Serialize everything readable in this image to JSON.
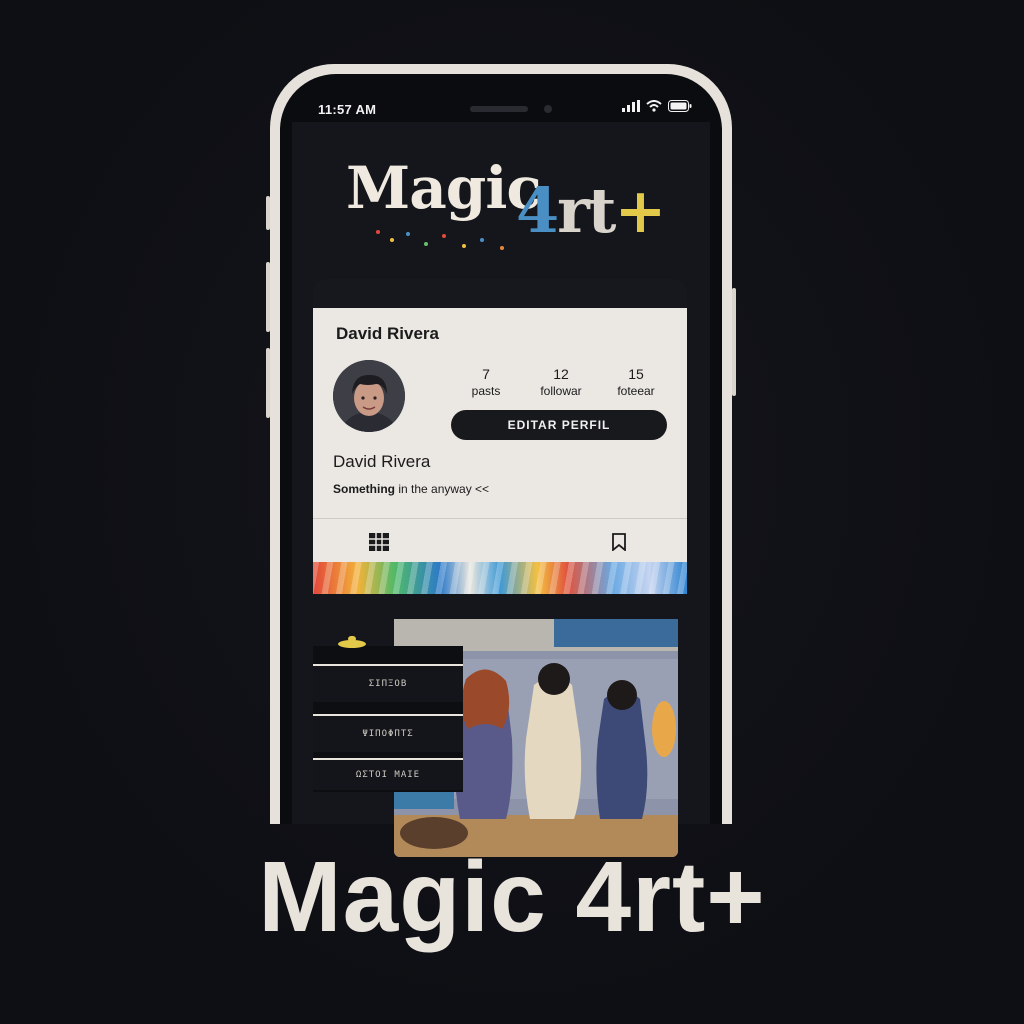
{
  "status_bar": {
    "time": "11:57 AM"
  },
  "logo": {
    "word": "Magic",
    "num": "4",
    "rt": "rt",
    "plus": "+"
  },
  "profile": {
    "username": "David Rivera",
    "display_name": "David Rivera",
    "bio_bold": "Something",
    "bio_rest": " in the anyway <<",
    "stats": [
      {
        "value": "7",
        "label": "pasts"
      },
      {
        "value": "12",
        "label": "followar"
      },
      {
        "value": "15",
        "label": "foteear"
      }
    ],
    "edit_button": "EDITAR PERFIL"
  },
  "art_menu": {
    "items": [
      "ΣΙΠΞΟΒ",
      "ΨΙΠΟΦΠΤΣ",
      "ΩΣΤΟΙ ΜΑΙΕ"
    ]
  },
  "caption": "Magic 4rt+",
  "colors": {
    "background": "#101116",
    "phone_frame": "#e6e1da",
    "card": "#ebe8e3",
    "logo_blue": "#4a8fc4",
    "logo_yellow": "#e3c94a"
  },
  "icons": [
    "signal-icon",
    "wifi-icon",
    "battery-icon",
    "grid-icon",
    "bookmark-icon"
  ]
}
